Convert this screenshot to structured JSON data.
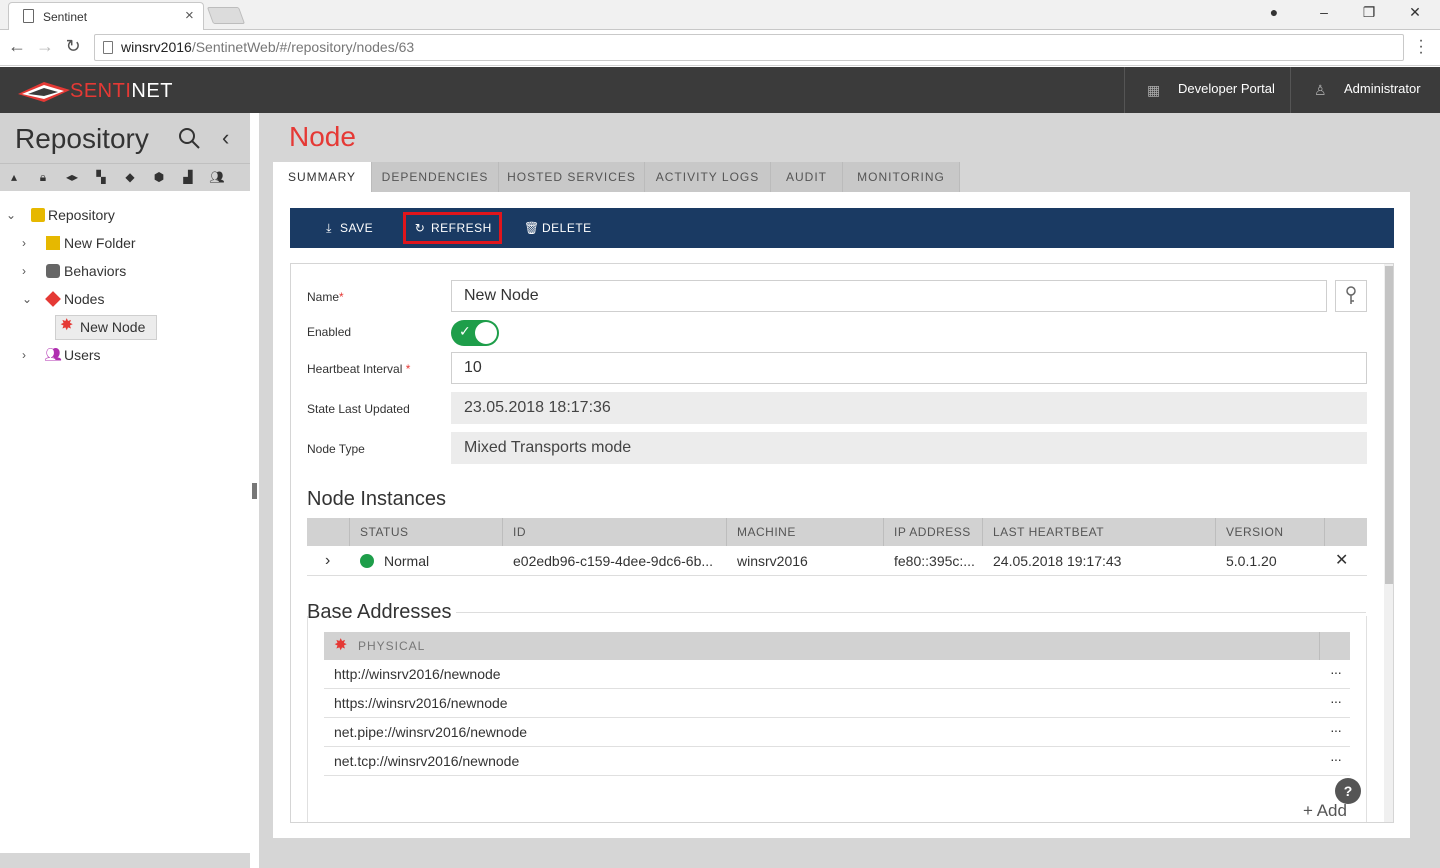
{
  "browser": {
    "tab_title": "Sentinet",
    "url_host": "winsrv2016",
    "url_path": "/SentinetWeb/#/repository/nodes/63"
  },
  "header": {
    "logo_text_red": "SENTI",
    "logo_text_white": "NET",
    "developer_portal": "Developer Portal",
    "user": "Administrator"
  },
  "sidebar": {
    "title": "Repository",
    "tree": [
      {
        "label": "Repository"
      },
      {
        "label": "New Folder"
      },
      {
        "label": "Behaviors"
      },
      {
        "label": "Nodes"
      },
      {
        "label": "New Node"
      },
      {
        "label": "Users"
      }
    ]
  },
  "page": {
    "title": "Node",
    "tabs": [
      "SUMMARY",
      "DEPENDENCIES",
      "HOSTED SERVICES",
      "ACTIVITY LOGS",
      "AUDIT",
      "MONITORING"
    ],
    "toolbar": {
      "save": "SAVE",
      "refresh": "REFRESH",
      "delete": "DELETE"
    },
    "form": {
      "name_label": "Name",
      "name_value": "New Node",
      "enabled_label": "Enabled",
      "heartbeat_label": "Heartbeat Interval",
      "heartbeat_value": "10",
      "state_label": "State Last Updated",
      "state_value": "23.05.2018 18:17:36",
      "type_label": "Node Type",
      "type_value": "Mixed Transports mode"
    },
    "instances": {
      "title": "Node Instances",
      "columns": [
        "STATUS",
        "ID",
        "MACHINE",
        "IP ADDRESS",
        "LAST HEARTBEAT",
        "VERSION"
      ],
      "rows": [
        {
          "status": "Normal",
          "id": "e02edb96-c159-4dee-9dc6-6b...",
          "machine": "winsrv2016",
          "ip": "fe80::395c:...",
          "heartbeat": "24.05.2018 19:17:43",
          "version": "5.0.1.20"
        }
      ]
    },
    "base_addresses": {
      "title": "Base Addresses",
      "group": "PHYSICAL",
      "items": [
        "http://winsrv2016/newnode",
        "https://winsrv2016/newnode",
        "net.pipe://winsrv2016/newnode",
        "net.tcp://winsrv2016/newnode"
      ],
      "add": "+ Add"
    },
    "help": "?"
  },
  "colors": {
    "accent": "#e53935",
    "toolbar": "#1a3a63",
    "status_ok": "#1e9e4a"
  }
}
